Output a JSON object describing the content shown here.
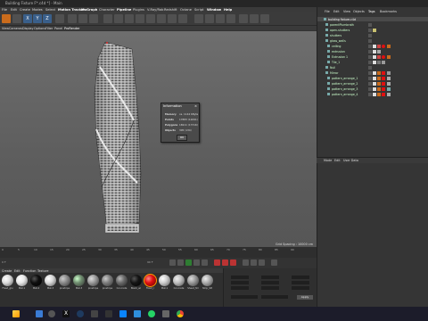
{
  "window": {
    "title": "Building Fixture F*.c4d *] - Main"
  },
  "menu": [
    "File",
    "Edit",
    "Create",
    "Modes",
    "Select",
    "Motion Tracker",
    "MoGraph",
    "Character",
    "Pipeline",
    "Plugins",
    "V-Ray/Rab",
    "Redshift",
    "Octane",
    "Script",
    "Window",
    "Help"
  ],
  "view_menu": [
    "View",
    "Cameras",
    "Display",
    "Options",
    "Filter",
    "Panel",
    "ProRender"
  ],
  "toolbar": {
    "xyz_labels": [
      "X",
      "Y",
      "Z"
    ]
  },
  "viewport": {
    "grid_spacing": "Grid Spacing : 10000 cm"
  },
  "timeline": {
    "ticks": [
      "0",
      "5",
      "10",
      "15",
      "20",
      "25",
      "30",
      "35",
      "40",
      "45",
      "50",
      "55",
      "60",
      "65",
      "70",
      "75",
      "80",
      "85",
      "90"
    ],
    "frame_start": "0 F",
    "frame_end": "90 F"
  },
  "materials": {
    "menu": [
      "Create",
      "Edit",
      "Function",
      "Texture"
    ],
    "items": [
      {
        "label": "Fixed_glu",
        "color": "#dcdcdc"
      },
      {
        "label": "Mat.1",
        "color": "#e8e8e8"
      },
      {
        "label": "Mat.4",
        "color": "#0f0f0f"
      },
      {
        "label": "Mat.3",
        "color": "#d8d8d8"
      },
      {
        "label": "pinstripe",
        "color": "#8a8a8a"
      },
      {
        "label": "Mat.3",
        "color": "#6f8c6f"
      },
      {
        "label": "pinstripe",
        "color": "#9a9a9a"
      },
      {
        "label": "pinstripe",
        "color": "#7e7e7e"
      },
      {
        "label": "Concrete",
        "color": "#6a6a6a"
      },
      {
        "label": "Black_wi",
        "color": "#151515"
      },
      {
        "label": "Fixed_r",
        "color": "#e01010"
      },
      {
        "label": "Mat.1",
        "color": "#cccccc"
      },
      {
        "label": "Concrete",
        "color": "#bdbdbd"
      },
      {
        "label": "Sheet_Str",
        "color": "#999999"
      },
      {
        "label": "Strip_Stt",
        "color": "#aaaaaa"
      }
    ]
  },
  "coords": {
    "apply_label": "Apply"
  },
  "objects": {
    "tabs": [
      "File",
      "Edit",
      "View",
      "Objects",
      "Tags",
      "Bookmarks"
    ],
    "items": [
      {
        "name": "building fixture.c4d",
        "indent": 0
      },
      {
        "name": "parentPlumbrath",
        "indent": 1
      },
      {
        "name": "open-shutters",
        "indent": 1
      },
      {
        "name": "shutters",
        "indent": 1
      },
      {
        "name": "glass_walls",
        "indent": 1
      },
      {
        "name": "ceiling",
        "indent": 2
      },
      {
        "name": "extrusion",
        "indent": 2
      },
      {
        "name": "Extrusion 1",
        "indent": 2
      },
      {
        "name": "Tile_1",
        "indent": 2
      },
      {
        "name": "Null",
        "indent": 1
      },
      {
        "name": "Mirror",
        "indent": 1
      },
      {
        "name": "pattern_arrange_1",
        "indent": 2
      },
      {
        "name": "pattern_arrange_2",
        "indent": 2
      },
      {
        "name": "pattern_arrange_3",
        "indent": 2
      },
      {
        "name": "pattern_arrange_4",
        "indent": 2
      }
    ]
  },
  "attributes": {
    "tabs": [
      "Mode",
      "Edit",
      "User Data"
    ]
  },
  "dialog": {
    "title": "Information",
    "rows": [
      {
        "label": "Memory",
        "value": "ca. 1144 KByte"
      },
      {
        "label": "Points",
        "value": "17883 (12691)"
      },
      {
        "label": "Polygons",
        "value": "16911 (17316)"
      },
      {
        "label": "Objects",
        "value": "305 (134)"
      }
    ],
    "ok_label": "OK"
  },
  "taskbar": {
    "icons": [
      "windows-icon",
      "search-icon",
      "task-view-icon",
      "x-app-icon",
      "cinema4d-icon",
      "edge-icon",
      "explorer-icon",
      "vscode-icon",
      "whatsapp-icon",
      "chrome-icon"
    ]
  },
  "colors": {
    "accent": "#c96b1c",
    "selection": "#3a5f8a"
  }
}
